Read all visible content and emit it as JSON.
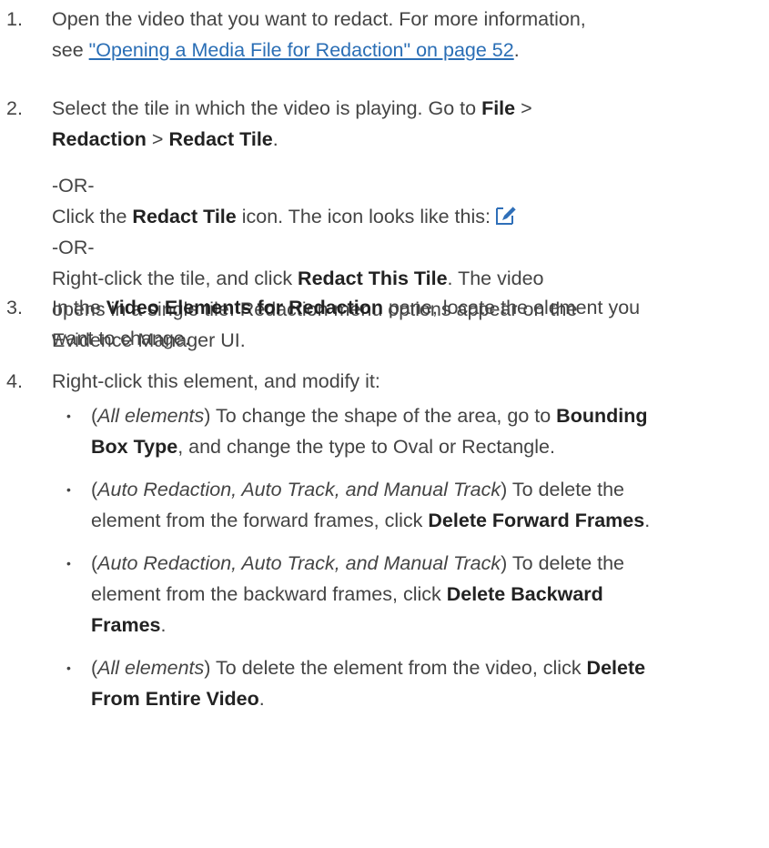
{
  "steps": [
    {
      "num": "1.",
      "lines": [
        [
          "Open the video that you want to redact. For more information,"
        ],
        [
          "see ",
          {
            "link": "\"Opening a Media File for Redaction\" on page 52"
          },
          "."
        ]
      ]
    },
    {
      "num": "2.",
      "lines": [
        [
          "Select the tile in which the video is playing. Go to ",
          {
            "b": "File"
          },
          " >"
        ],
        [
          {
            "b": "Redaction"
          },
          " > ",
          {
            "b": "Redact Tile"
          },
          "."
        ]
      ],
      "extra": [
        [
          "-OR-"
        ],
        [
          "Click the ",
          {
            "b": "Redact Tile"
          },
          " icon. The icon looks like this:",
          {
            "icon": "redact-tile-icon"
          }
        ],
        [
          "-OR-"
        ],
        [
          "Right-click the tile, and click ",
          {
            "b": "Redact This Tile"
          },
          ". The video"
        ],
        [
          "opens in a single tile. Redaction menu options appear on the"
        ],
        [
          "Evidence Manager UI."
        ]
      ]
    },
    {
      "num": "3.",
      "lines": [
        [
          "In the ",
          {
            "b": "Video Elements for Redaction"
          },
          " pane, locate the element you"
        ],
        [
          "want to change."
        ]
      ]
    },
    {
      "num": "4.",
      "lines": [
        [
          "Right-click this element, and modify it:"
        ]
      ]
    }
  ],
  "bullets": [
    {
      "glyph": "•",
      "lines": [
        [
          "(",
          {
            "i": "All elements"
          },
          ") To change the shape of the area, go to ",
          {
            "b": "Bounding"
          }
        ],
        [
          {
            "b": "Box Type"
          },
          ", and change the type to Oval or Rectangle."
        ]
      ]
    },
    {
      "glyph": "•",
      "lines": [
        [
          "(",
          {
            "i": "Auto Redaction, Auto Track, and Manual Track"
          },
          ") To delete the"
        ],
        [
          "element from the forward frames, click ",
          {
            "b": "Delete Forward Frames"
          },
          "."
        ]
      ]
    },
    {
      "glyph": "•",
      "lines": [
        [
          "(",
          {
            "i": "Auto Redaction, Auto Track, and Manual Track"
          },
          ") To delete the"
        ],
        [
          "element from the backward frames, click ",
          {
            "b": "Delete Backward"
          }
        ],
        [
          {
            "b": "Frames"
          },
          "."
        ]
      ]
    },
    {
      "glyph": "•",
      "lines": [
        [
          "(",
          {
            "i": "All elements"
          },
          ") To delete the element from the video, click ",
          {
            "b": "Delete"
          }
        ],
        [
          {
            "b": "From Entire Video"
          },
          "."
        ]
      ]
    }
  ],
  "colors": {
    "text": "#444444",
    "bold": "#222222",
    "link": "#2a6eb5",
    "icon_blue": "#2f6fb8"
  }
}
